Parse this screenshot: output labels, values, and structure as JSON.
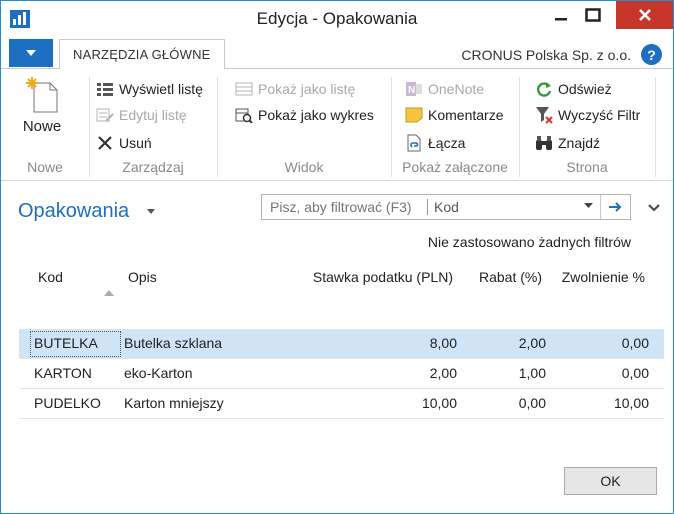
{
  "window": {
    "title": "Edycja - Opakowania"
  },
  "ribbon": {
    "tab_home": "NARZĘDZIA GŁÓWNE",
    "company": "CRONUS Polska Sp. z o.o.",
    "help_glyph": "?",
    "groups": {
      "nowe": {
        "label": "Nowe",
        "new_button": "Nowe"
      },
      "zarzadzaj": {
        "label": "Zarządzaj",
        "show_list": "Wyświetl listę",
        "edit_list": "Edytuj listę",
        "delete": "Usuń"
      },
      "widok": {
        "label": "Widok",
        "show_as_list": "Pokaż jako listę",
        "show_as_chart": "Pokaż jako wykres"
      },
      "zalaczone": {
        "label": "Pokaż załączone",
        "onenote": "OneNote",
        "notes": "Komentarze",
        "links": "Łącza"
      },
      "strona": {
        "label": "Strona",
        "refresh": "Odśwież",
        "clear_filter": "Wyczyść Filtr",
        "find": "Znajdź"
      }
    }
  },
  "list": {
    "title": "Opakowania",
    "filter_placeholder": "Pisz, aby filtrować (F3)",
    "filter_field": "Kod",
    "no_filters": "Nie zastosowano żadnych filtrów",
    "columns": {
      "code": "Kod",
      "desc": "Opis",
      "tax": "Stawka podatku (PLN)",
      "discount": "Rabat (%)",
      "exempt": "Zwolnienie %"
    },
    "rows": [
      {
        "code": "BUTELKA",
        "desc": "Butelka szklana",
        "tax": "8,00",
        "discount": "2,00",
        "exempt": "0,00"
      },
      {
        "code": "KARTON",
        "desc": "eko-Karton",
        "tax": "2,00",
        "discount": "1,00",
        "exempt": "0,00"
      },
      {
        "code": "PUDELKO",
        "desc": "Karton mniejszy",
        "tax": "10,00",
        "discount": "0,00",
        "exempt": "10,00"
      }
    ]
  },
  "footer": {
    "ok": "OK"
  },
  "colors": {
    "accent": "#1c6fc1",
    "close": "#c7362a",
    "selected_row": "#cfe5f5"
  }
}
